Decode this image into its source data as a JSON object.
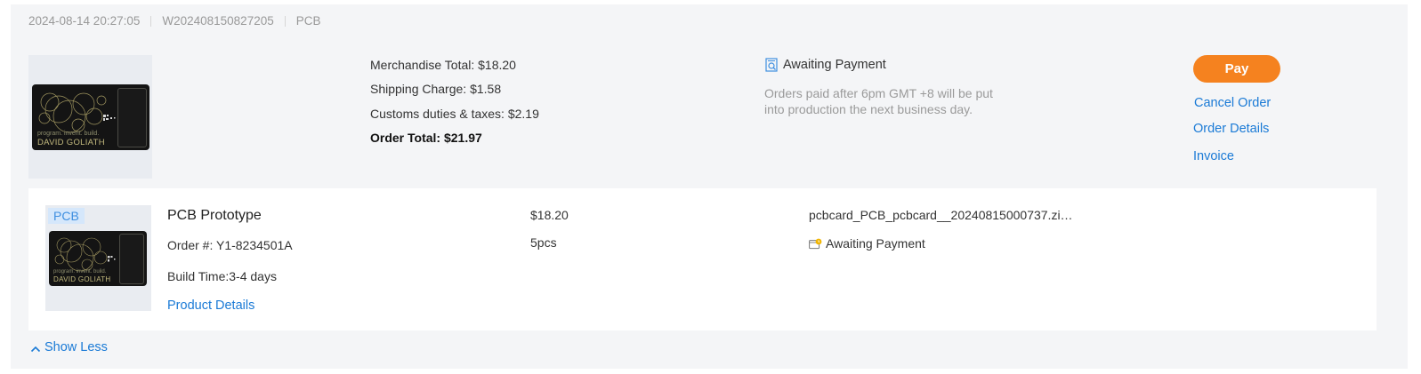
{
  "order": {
    "datetime": "2024-08-14 20:27:05",
    "order_number": "W202408150827205",
    "category": "PCB"
  },
  "thumbnail": {
    "tagline": "program. invent. build.",
    "name": "DAVID GOLIATH"
  },
  "summary": {
    "merchandise_total": "Merchandise Total: $18.20",
    "shipping_charge": "Shipping Charge: $1.58",
    "customs": "Customs duties & taxes: $2.19",
    "order_total": "Order Total: $21.97"
  },
  "status": {
    "label": "Awaiting Payment",
    "note": "Orders paid after 6pm GMT +8 will be put into production the next business day.",
    "icon": "search-document-icon"
  },
  "actions": {
    "pay": "Pay",
    "cancel": "Cancel Order",
    "details": "Order Details",
    "invoice": "Invoice"
  },
  "item": {
    "badge": "PCB",
    "title": "PCB Prototype",
    "order_no": "Order #: Y1-8234501A",
    "build_time": "Build Time:3-4 days",
    "product_details": "Product Details",
    "price": "$18.20",
    "quantity": "5pcs",
    "file": "pcbcard_PCB_pcbcard__20240815000737.zi…",
    "status": "Awaiting Payment",
    "status_icon": "wallet-clock-icon"
  },
  "toggle": {
    "label": "Show Less",
    "icon": "chevron-up-icon"
  },
  "colors": {
    "accent": "#f5821f",
    "link": "#1a7ad6",
    "card_bg": "#f4f5f7"
  }
}
